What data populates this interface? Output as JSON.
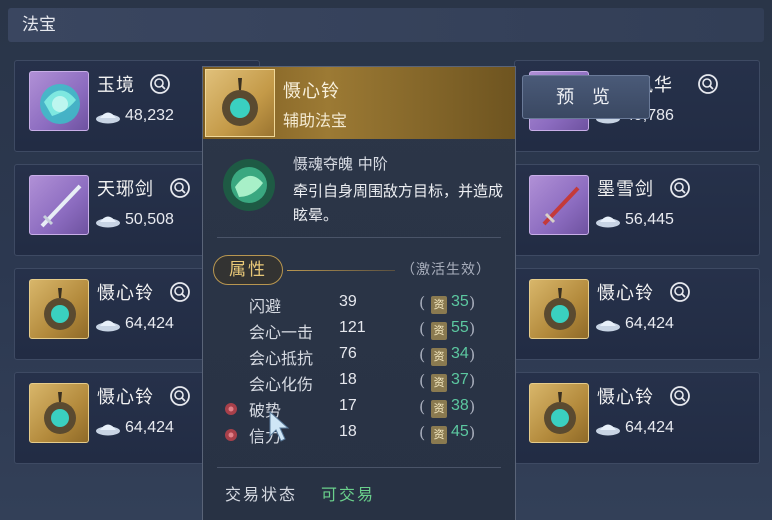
{
  "section": {
    "title": "法宝"
  },
  "preview_button": {
    "label": "预 览"
  },
  "cards": [
    {
      "name": "玉境",
      "price": "48,232",
      "icon": "jade-gem-icon",
      "frame": "purple"
    },
    {
      "name": "风华",
      "price": "49,786",
      "icon": "gem-icon",
      "frame": "purple"
    },
    {
      "name": "天琊剑",
      "price": "50,508",
      "icon": "sword-icon",
      "frame": "purple"
    },
    {
      "name": "墨雪剑",
      "price": "56,445",
      "icon": "sword-icon",
      "frame": "purple"
    },
    {
      "name": "慑心铃",
      "price": "64,424",
      "icon": "bell-icon",
      "frame": "gold"
    },
    {
      "name": "慑心铃",
      "price": "64,424",
      "icon": "bell-icon",
      "frame": "gold"
    },
    {
      "name": "慑心铃",
      "price": "64,424",
      "icon": "bell-icon",
      "frame": "gold"
    },
    {
      "name": "慑心铃",
      "price": "64,424",
      "icon": "bell-icon",
      "frame": "gold"
    }
  ],
  "tooltip": {
    "name": "慑心铃",
    "type": "辅助法宝",
    "skill_title": "慑魂夺魄 中阶",
    "skill_desc": "牵引自身周围敌方目标，并造成眩晕。",
    "attr_header": "属性",
    "activate_note": "（激活生效）",
    "stats": [
      {
        "label": "闪避",
        "value": "39",
        "tag": "资",
        "gain": "35",
        "marked": false
      },
      {
        "label": "会心一击",
        "value": "121",
        "tag": "资",
        "gain": "55",
        "marked": false
      },
      {
        "label": "会心抵抗",
        "value": "76",
        "tag": "资",
        "gain": "34",
        "marked": false
      },
      {
        "label": "会心化伤",
        "value": "18",
        "tag": "资",
        "gain": "37",
        "marked": false
      },
      {
        "label": "破势",
        "value": "17",
        "tag": "资",
        "gain": "38",
        "marked": true
      },
      {
        "label": "信力",
        "value": "18",
        "tag": "资",
        "gain": "45",
        "marked": true
      }
    ],
    "paren_open": "(",
    "paren_close": ")",
    "trade_label": "交易状态",
    "trade_value": "可交易"
  },
  "colors": {
    "gold_frame": "#c49a48",
    "purple_frame": "#8c6cc0",
    "gain_green": "#5cc8a0",
    "tradable_green": "#6ad08c"
  }
}
